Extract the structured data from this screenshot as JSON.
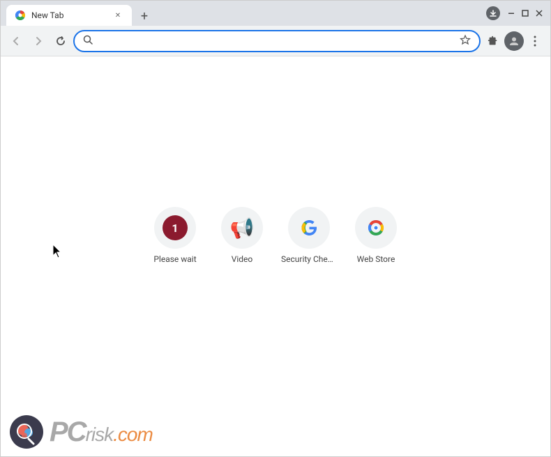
{
  "browser": {
    "tab": {
      "title": "New Tab",
      "favicon": "chrome-icon"
    },
    "new_tab_label": "+",
    "window_controls": {
      "minimize": "—",
      "maximize": "☐",
      "close": "✕"
    },
    "toolbar": {
      "back_label": "‹",
      "forward_label": "›",
      "reload_label": "↻",
      "address_placeholder": "",
      "address_value": "",
      "star_label": "☆",
      "extensions_label": "🧩",
      "menu_label": "⋮"
    }
  },
  "page": {
    "shortcuts": [
      {
        "id": "please-wait",
        "label": "Please wait",
        "icon_type": "badge",
        "badge_text": "1"
      },
      {
        "id": "video",
        "label": "Video",
        "icon_type": "emoji",
        "emoji": "📢"
      },
      {
        "id": "security-check",
        "label": "Security Chec...",
        "icon_type": "google-g"
      },
      {
        "id": "web-store",
        "label": "Web Store",
        "icon_type": "webstore"
      }
    ]
  },
  "watermark": {
    "text_pc": "PC",
    "text_risk": "risk",
    "text_dotcom": ".com"
  },
  "cursor": {
    "visible": true
  }
}
